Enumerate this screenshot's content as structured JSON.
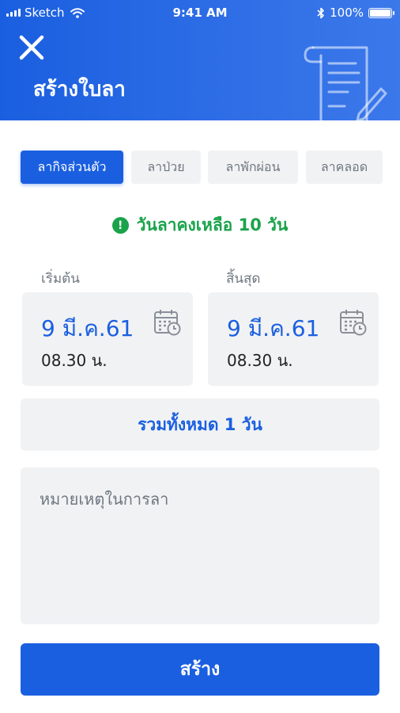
{
  "status_bar": {
    "carrier": "Sketch",
    "time": "9:41 AM",
    "battery": "100%"
  },
  "header": {
    "title": "สร้างใบลา",
    "icons": [
      "close-icon",
      "document-pen-icon"
    ]
  },
  "tabs": [
    {
      "label": "ลากิจส่วนตัว",
      "active": true
    },
    {
      "label": "ลาป่วย",
      "active": false
    },
    {
      "label": "ลาพักผ่อน",
      "active": false
    },
    {
      "label": "ลาคลอด",
      "active": false
    }
  ],
  "remaining": {
    "text": "วันลาคงเหลือ 10 วัน",
    "icon": "alert-icon",
    "color": "#1aa34a"
  },
  "start": {
    "label": "เริ่มต้น",
    "date": "9 มี.ค.61",
    "time": "08.30 น."
  },
  "end": {
    "label": "สิ้นสุด",
    "date": "9 มี.ค.61",
    "time": "08.30 น."
  },
  "total": {
    "text": "รวมทั้งหมด 1 วัน"
  },
  "note": {
    "placeholder": "หมายเหตุในการลา",
    "value": ""
  },
  "submit": {
    "label": "สร้าง"
  },
  "colors": {
    "primary": "#1a5fe0",
    "success": "#1aa34a",
    "muted": "#6f7780",
    "surface": "#f1f2f4"
  }
}
